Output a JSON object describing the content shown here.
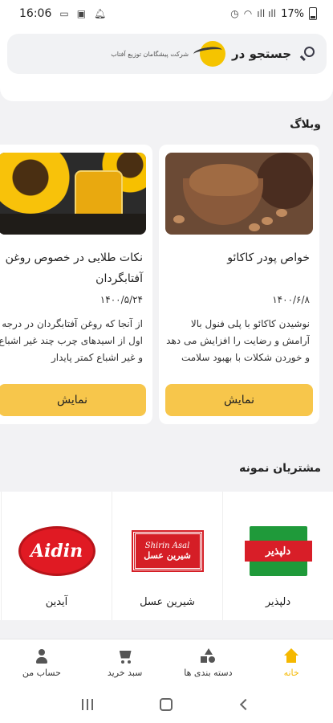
{
  "status_bar": {
    "time": "16:06",
    "battery": "17%",
    "signal": "ıll ıll"
  },
  "search": {
    "label": "جستجو در",
    "brand_text": "شرکت پیشگامان توزیع آفتاب"
  },
  "blog": {
    "section_title": "وبلاگ",
    "posts": [
      {
        "title": "خواص پودر کاکائو",
        "date": "۱۴۰۰/۶/۸",
        "excerpt": "نوشیدن کاکائو با پلی فنول بالا آرامش و رضایت را افزایش می دهد و خوردن شکلات با بهبود سلامت",
        "button": "نمایش"
      },
      {
        "title": "نکات طلایی در خصوص روغن آفتابگردان",
        "date": "۱۴۰۰/۵/۲۴",
        "excerpt": "از آنجا که روغن آفتابگردان در درجه اول از اسیدهای چرب چند غیر اشباع و غیر اشباع کمتر پایدار",
        "button": "نمایش"
      }
    ]
  },
  "customers": {
    "section_title": "مشتریان نمونه",
    "items": [
      {
        "name": "دلپذیر",
        "logo_text": "دلپذیر"
      },
      {
        "name": "شیرین عسل",
        "logo_text": "Shirin Asal",
        "logo_sub": "شیرین عسل"
      },
      {
        "name": "آیدین",
        "logo_text": "Aidin"
      }
    ]
  },
  "bottom_nav": {
    "items": [
      {
        "label": "خانه",
        "icon": "home-icon",
        "active": true
      },
      {
        "label": "دسته بندی ها",
        "icon": "categories-icon",
        "active": false
      },
      {
        "label": "سبد خرید",
        "icon": "cart-icon",
        "active": false
      },
      {
        "label": "حساب من",
        "icon": "account-icon",
        "active": false
      }
    ]
  },
  "colors": {
    "accent": "#f7c64b",
    "active_nav": "#f5b800",
    "background": "#f2f2f4"
  }
}
